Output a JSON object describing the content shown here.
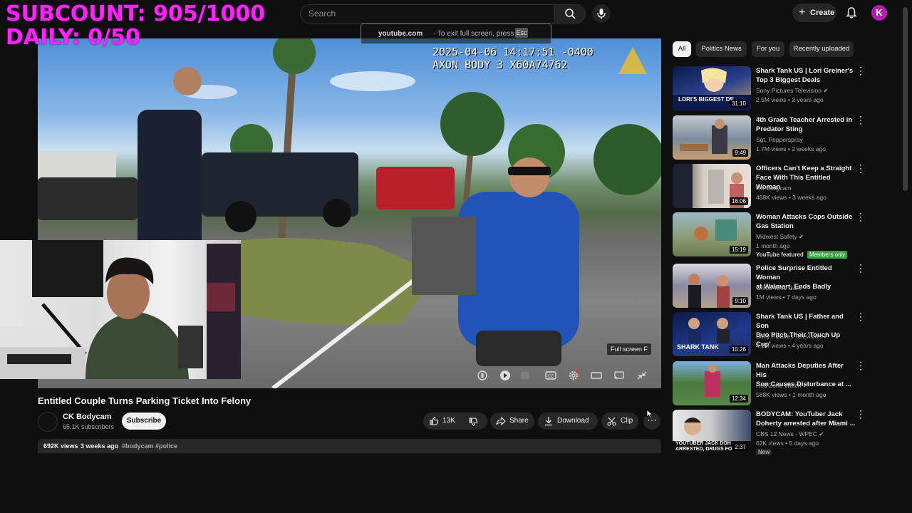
{
  "overlay": {
    "subcount": "SUBCOUNT: 905/1000",
    "daily": "DAILY: 0/50"
  },
  "topbar": {
    "search_placeholder": "Search",
    "create_label": "Create",
    "avatar_letter": "K"
  },
  "fullscreen_notice": {
    "site": "youtube.com",
    "hint": "·  To exit full screen, press",
    "key": "Esc"
  },
  "player": {
    "timestamp_line1": "2025-04-06 14:17:51 -0400",
    "timestamp_line2": "AXON BODY 3 X60A74762",
    "tooltip": "Full screen  F"
  },
  "video": {
    "title": "Entitled Couple Turns Parking Ticket Into Felony",
    "channel": "CK Bodycam",
    "subscribers": "65.1K subscribers",
    "subscribe_label": "Subscribe",
    "likes": "13K",
    "share_label": "Share",
    "download_label": "Download",
    "clip_label": "Clip",
    "views": "692K views",
    "age": "3 weeks ago",
    "tags": "#bodycam #police"
  },
  "chips": [
    "All",
    "Politics News",
    "For you",
    "Recently uploaded"
  ],
  "recommendations": [
    {
      "title1": "Shark Tank US | Lori Greiner's",
      "title2": "Top 3 Biggest Deals",
      "channel": "Sony Pictures Television",
      "verified": true,
      "meta": "2.5M views • 2 years ago",
      "duration": "31:10",
      "thumb_text": "LORI'S BIGGEST DE"
    },
    {
      "title1": "4th Grade Teacher Arrested in",
      "title2": "Predator Sting",
      "channel": "Sgt. Pepperspray",
      "verified": false,
      "meta": "1.7M views • 2 weeks ago",
      "duration": "9:49",
      "thumb_text": ""
    },
    {
      "title1": "Officers Can't Keep a Straight",
      "title2": "Face With This Entitled Woman",
      "channel": "CK Bodycam",
      "verified": false,
      "meta": "488K views • 3 weeks ago",
      "duration": "16:06",
      "thumb_text": ""
    },
    {
      "title1": "Woman Attacks Cops Outside",
      "title2": "Gas Station",
      "channel": "Midwest Safety",
      "verified": true,
      "meta": "1 month ago",
      "duration": "15:19",
      "thumb_text": "",
      "featured": "YouTube featured",
      "members": "Members only"
    },
    {
      "title1": "Police Surprise Entitled Woman",
      "title2": "at Walmart, Ends Badly",
      "channel": "Crime Time Cam",
      "verified": false,
      "meta": "1M views • 7 days ago",
      "duration": "9:10",
      "thumb_text": ""
    },
    {
      "title1": "Shark Tank US | Father and Son",
      "title2": "Duo Pitch Their 'Touch Up Cup'",
      "channel": "Sony Pictures Television",
      "verified": true,
      "meta": "4.1M views • 4 years ago",
      "duration": "10:26",
      "thumb_text": "SHARK TANK"
    },
    {
      "title1": "Man Attacks Deputies After His",
      "title2": "Son Causes Disturbance at ...",
      "channel": "Red Zone Watch",
      "verified": true,
      "meta": "588K views • 1 month ago",
      "duration": "12:34",
      "thumb_text": ""
    },
    {
      "title1": "BODYCAM: YouTuber Jack",
      "title2": "Doherty arrested after Miami ...",
      "channel": "CBS 12 News - WPEC",
      "verified": true,
      "meta": "62K views • 5 days ago",
      "duration": "2:37",
      "thumb_text": "YOUTUBER JACK DOH ARRESTED, DRUGS FO",
      "new": "New"
    }
  ]
}
